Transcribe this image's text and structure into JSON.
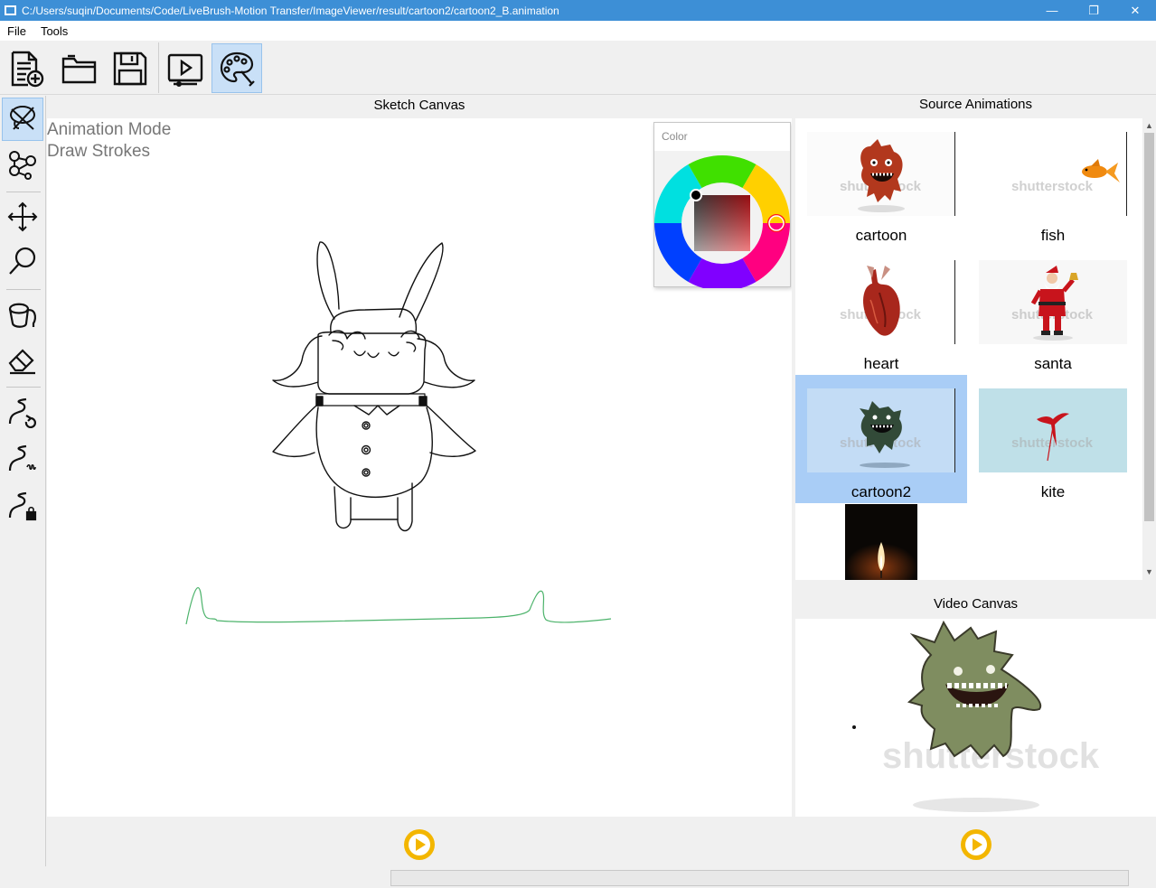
{
  "window": {
    "title": "C:/Users/suqin/Documents/Code/LiveBrush-Motion Transfer/ImageViewer/result/cartoon2/cartoon2_B.animation",
    "minimize_glyph": "—",
    "restore_glyph": "❐",
    "close_glyph": "✕"
  },
  "menu": {
    "file": "File",
    "tools": "Tools"
  },
  "toolbar": {
    "icons": [
      "new-file-icon",
      "open-folder-icon",
      "save-icon",
      "video-player-icon",
      "palette-icon"
    ],
    "active": "palette-icon"
  },
  "left_tools": {
    "icons": [
      "lasso-icon",
      "graph-nodes-icon",
      "move-icon",
      "zoom-icon",
      "paint-bucket-icon",
      "eraser-icon",
      "stroke-rotate-icon",
      "stroke-spring-icon",
      "stroke-lock-icon"
    ],
    "active": "lasso-icon"
  },
  "sketch": {
    "title": "Sketch Canvas",
    "mode_line1": "Animation Mode",
    "mode_line2": "Draw Strokes",
    "stroke_color": "#4cb36b"
  },
  "color_picker": {
    "label": "Color",
    "selected_hue": "red",
    "selected_color": "#000000"
  },
  "source": {
    "title": "Source Animations",
    "items": [
      {
        "label": "cartoon",
        "watermark": "shutterstock"
      },
      {
        "label": "fish",
        "watermark": "shutterstock"
      },
      {
        "label": "heart",
        "watermark": "shutterstock"
      },
      {
        "label": "santa",
        "watermark": "shutterstock"
      },
      {
        "label": "cartoon2",
        "watermark": "shutterstock"
      },
      {
        "label": "kite",
        "watermark": "shutterstock"
      }
    ],
    "selected": "cartoon2"
  },
  "video": {
    "title": "Video Canvas",
    "watermark": "shutterstock"
  },
  "colors": {
    "accent": "#3d8fd6",
    "selection": "#a9cdf6",
    "play": "#f3b600"
  }
}
